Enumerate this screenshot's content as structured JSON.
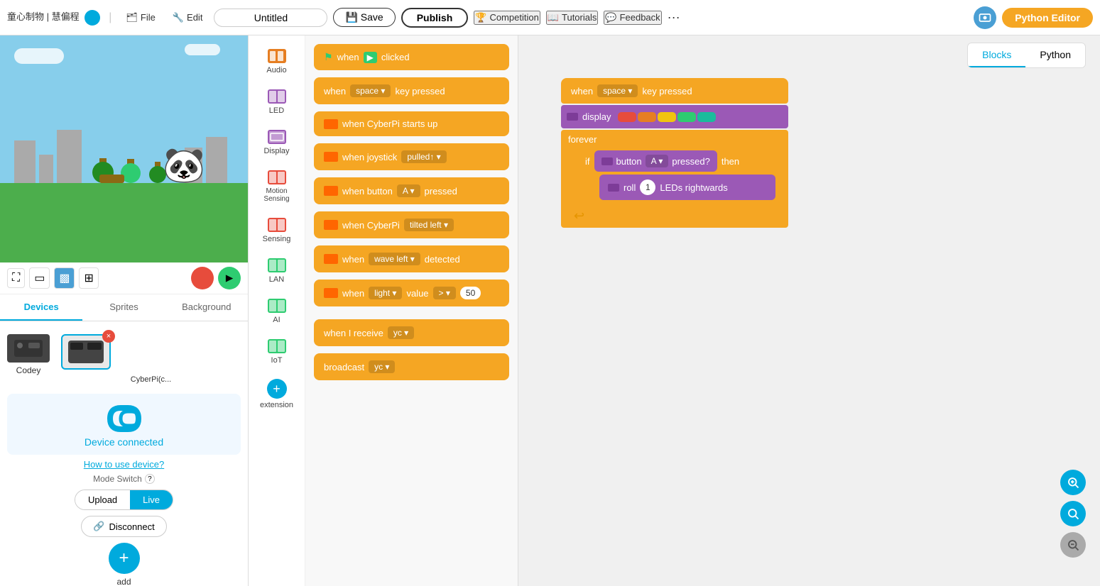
{
  "topnav": {
    "brand": "童心制物 | 慧偏程",
    "file_label": "File",
    "edit_label": "Edit",
    "title_value": "Untitled",
    "save_label": "Save",
    "publish_label": "Publish",
    "competition_label": "Competition",
    "tutorials_label": "Tutorials",
    "feedback_label": "Feedback",
    "more_label": "···",
    "python_editor_label": "Python Editor"
  },
  "left_panel": {
    "tabs": [
      "Devices",
      "Sprites",
      "Background"
    ],
    "active_tab": "Devices",
    "codey_label": "Codey",
    "cyberpi_label": "CyberPi(c...",
    "connected_text": "Device connected",
    "how_to_label": "How to use device?",
    "mode_switch_label": "Mode Switch",
    "upload_label": "Upload",
    "live_label": "Live",
    "disconnect_label": "Disconnect",
    "add_label": "add"
  },
  "categories": [
    {
      "id": "audio",
      "label": "Audio",
      "color": "#e67e22"
    },
    {
      "id": "led",
      "label": "LED",
      "color": "#9b59b6"
    },
    {
      "id": "display",
      "label": "Display",
      "color": "#9b59b6"
    },
    {
      "id": "motion",
      "label": "Motion Sensing",
      "color": "#e74c3c"
    },
    {
      "id": "sensing",
      "label": "Sensing",
      "color": "#e74c3c"
    },
    {
      "id": "lan",
      "label": "LAN",
      "color": "#2ecc71"
    },
    {
      "id": "ai",
      "label": "AI",
      "color": "#2ecc71"
    },
    {
      "id": "iot",
      "label": "IoT",
      "color": "#2ecc71"
    },
    {
      "id": "extension",
      "label": "extension",
      "color": "#00aadd"
    }
  ],
  "blocks": [
    {
      "id": "when_clicked",
      "text": "when  clicked",
      "has_flag": true
    },
    {
      "id": "when_key",
      "text": "when  space ▾  key pressed",
      "has_cyberpi": false
    },
    {
      "id": "when_cyberpi_starts",
      "text": "when CyberPi starts up",
      "has_cyberpi": true
    },
    {
      "id": "when_joystick",
      "text": "when joystick  pulled↑ ▾",
      "has_cyberpi": true
    },
    {
      "id": "when_button",
      "text": "when button  A ▾  pressed",
      "has_cyberpi": true
    },
    {
      "id": "when_cyberpi_tilted",
      "text": "when CyberPi  tilted left ▾",
      "has_cyberpi": true
    },
    {
      "id": "when_wave",
      "text": "when  wave left ▾  detected",
      "has_cyberpi": true
    },
    {
      "id": "when_light",
      "text": "when  light ▾  value  > ▾  50",
      "has_cyberpi": true
    },
    {
      "id": "when_receive",
      "text": "when I receive  yc ▾"
    },
    {
      "id": "broadcast",
      "text": "broadcast  yc ▾"
    }
  ],
  "canvas": {
    "tabs": [
      "Blocks",
      "Python"
    ],
    "active_tab": "Blocks",
    "block_group": {
      "event_block": "when  space ▾  key pressed",
      "display_block": "display",
      "forever_label": "forever",
      "if_label": "if",
      "button_block": "button  A ▾  pressed?",
      "then_label": "then",
      "roll_block": "roll  1  LEDs rightwards"
    }
  },
  "zoom": {
    "in_label": "+",
    "reset_label": "○",
    "out_label": "−"
  }
}
